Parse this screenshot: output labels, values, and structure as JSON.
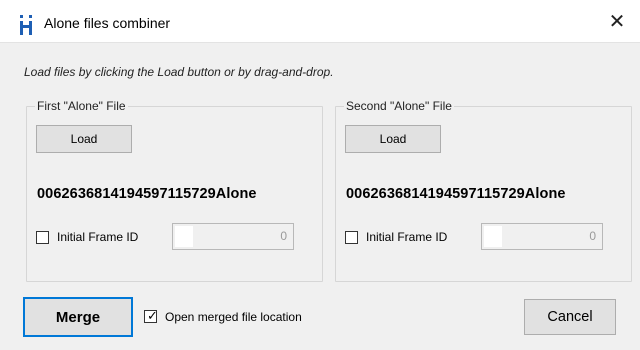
{
  "window": {
    "title": "Alone files combiner",
    "close_glyph": "✕",
    "app_icon": "app-logo-icon"
  },
  "instructions": "Load files by clicking the Load button or by drag-and-drop.",
  "first_group": {
    "title": "First \"Alone\" File",
    "load_label": "Load",
    "filename": "006263681419459711572​9Alone",
    "initial_frame_label": "Initial Frame ID",
    "initial_frame_checked": false,
    "initial_frame_value": "0"
  },
  "second_group": {
    "title": "Second \"Alone\" File",
    "load_label": "Load",
    "filename": "006263681419459711572​9Alone",
    "initial_frame_label": "Initial Frame ID",
    "initial_frame_checked": false,
    "initial_frame_value": "0"
  },
  "footer": {
    "merge_label": "Merge",
    "open_location_label": "Open merged file location",
    "open_location_checked": true,
    "cancel_label": "Cancel"
  },
  "colors": {
    "accent": "#0078d7",
    "client_bg": "#f0f0f0",
    "icon_blue": "#1e5fb4"
  }
}
